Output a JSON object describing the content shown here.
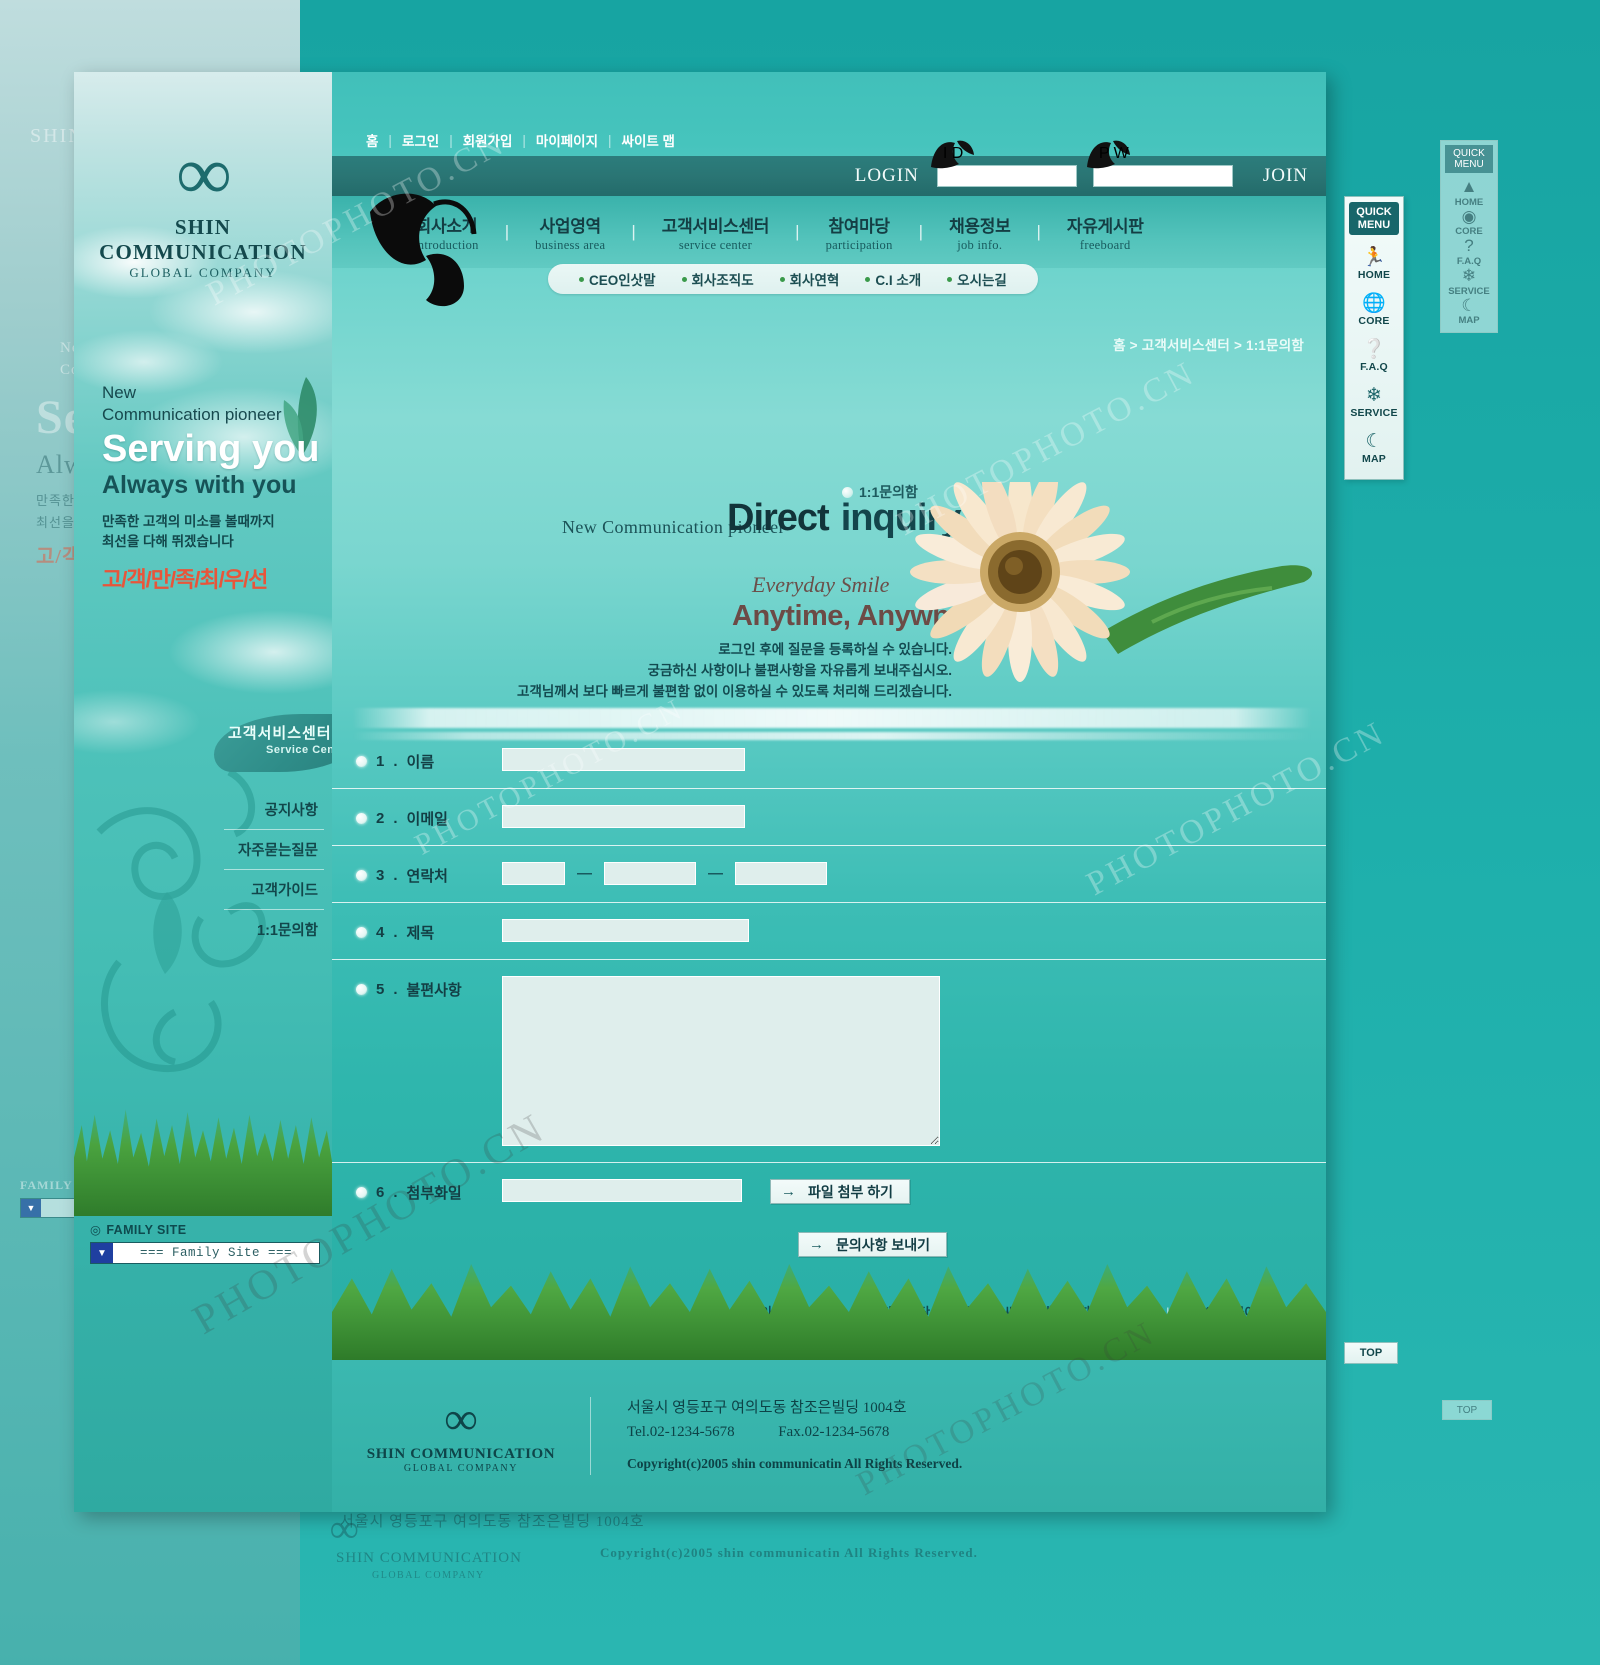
{
  "brand": {
    "name": "SHIN COMMUNICATION",
    "tagline": "GLOBAL COMPANY",
    "logo_glyph": "infinity-logo"
  },
  "util_nav": {
    "items": [
      "홈",
      "로그인",
      "회원가입",
      "마이페이지",
      "싸이트 맵"
    ],
    "separator": "|"
  },
  "login": {
    "label": "LOGIN",
    "id_tag": "I D",
    "pw_tag": "P W",
    "id_value": "",
    "pw_value": "",
    "id_placeholder": "",
    "pw_placeholder": "",
    "join_label": "JOIN"
  },
  "main_nav": {
    "items": [
      {
        "ko": "회사소개",
        "en": "introduction"
      },
      {
        "ko": "사업영역",
        "en": "business area"
      },
      {
        "ko": "고객서비스센터",
        "en": "service center"
      },
      {
        "ko": "참여마당",
        "en": "participation"
      },
      {
        "ko": "채용정보",
        "en": "job info."
      },
      {
        "ko": "자유게시판",
        "en": "freeboard"
      }
    ],
    "divider": "|"
  },
  "sub_nav": {
    "items": [
      "CEO인삿말",
      "회사조직도",
      "회사연혁",
      "C.I 소개",
      "오시는길"
    ]
  },
  "breadcrumb": {
    "text": "홈 > 고객서비스센터 > 1:1문의함"
  },
  "sidebar": {
    "promo": {
      "line1": "New",
      "line2": "Communication  pioneer",
      "headline": "Serving you",
      "subhead": "Always with you",
      "body_line1": "만족한 고객의 미소를 볼때까지",
      "body_line2": "최선을 다해 뛰겠습니다",
      "slogan": "고/객/만/족/최/우/선",
      "slogan_color": "#e8553a"
    },
    "section": {
      "title_ko": "고객서비스센터",
      "title_en": "Service Center"
    },
    "menu": [
      {
        "label": "공지사항"
      },
      {
        "label": "자주묻는질문"
      },
      {
        "label": "고객가이드"
      },
      {
        "label": "1:1문의함"
      }
    ],
    "family_site": {
      "title": "FAMILY SITE",
      "selected": "=== Family Site ===",
      "arrow": "▼"
    }
  },
  "hero": {
    "kicker": "New Communication  pioneer",
    "title_main": "Direct",
    "title_sub": "inquiry",
    "badge": "1:1문의함",
    "smile": "Everyday Smile",
    "anytime": "Anytime, Anywhere",
    "desc_line1": "로그인 후에 질문을 등록하실 수 있습니다.",
    "desc_line2": "궁금하신 사항이나 불편사항을 자유롭게 보내주십시오.",
    "desc_line3": "고객님께서 보다 빠르게 불편함 없이 이용하실 수 있도록 처리해 드리겠습니다."
  },
  "form": {
    "fields": [
      {
        "num": "1",
        "label": "이름",
        "type": "text",
        "value": ""
      },
      {
        "num": "2",
        "label": "이메일",
        "type": "text",
        "value": ""
      },
      {
        "num": "3",
        "label": "연락처",
        "type": "phone",
        "value1": "",
        "value2": "",
        "value3": "",
        "dash": "―"
      },
      {
        "num": "4",
        "label": "제목",
        "type": "text",
        "value": ""
      },
      {
        "num": "5",
        "label": "불편사항",
        "type": "textarea",
        "value": ""
      },
      {
        "num": "6",
        "label": "첨부화일",
        "type": "file",
        "value": ""
      }
    ],
    "attach_button": "파일 첨부 하기",
    "submit_button": "문의사항 보내기",
    "arrow_glyph": "→"
  },
  "footer_links": {
    "items": [
      "개인정보보호정책",
      "이메일무단수집거부",
      "싸이트맵",
      "찾아오시는 길",
      "무엇이든 물어 보세요"
    ],
    "separator": "|"
  },
  "footer": {
    "company": "SHIN COMMUNICATION",
    "company_sub": "GLOBAL COMPANY",
    "address": "서울시 영등포구 여의도동 참조은빌딩 1004호",
    "tel": "Tel.02-1234-5678",
    "fax": "Fax.02-1234-5678",
    "copyright": "Copyright(c)2005 shin communicatin All Rights Reserved."
  },
  "quick_menu": {
    "head_line1": "QUICK",
    "head_line2": "MENU",
    "items": [
      {
        "icon": "person-walking-icon",
        "glyph": "🚶",
        "label": "HOME"
      },
      {
        "icon": "globe-icon",
        "glyph": "🌐",
        "label": "CORE"
      },
      {
        "icon": "question-mark-icon",
        "glyph": "❓",
        "label": "F.A.Q"
      },
      {
        "icon": "snowflake-icon",
        "glyph": "❄",
        "label": "SERVICE"
      },
      {
        "icon": "moon-icon",
        "glyph": "☾",
        "label": "MAP"
      }
    ],
    "top_button": "TOP"
  },
  "watermark": {
    "text": "PHOTOPHOTO.CN"
  },
  "colors": {
    "teal_bg": "#41c0ba",
    "teal_dark": "#1a6a6d",
    "login_bar": "#2a7574",
    "accent_orange": "#e8553a",
    "grass_green": "#4aa33f",
    "input_bg": "#dfeeec"
  }
}
